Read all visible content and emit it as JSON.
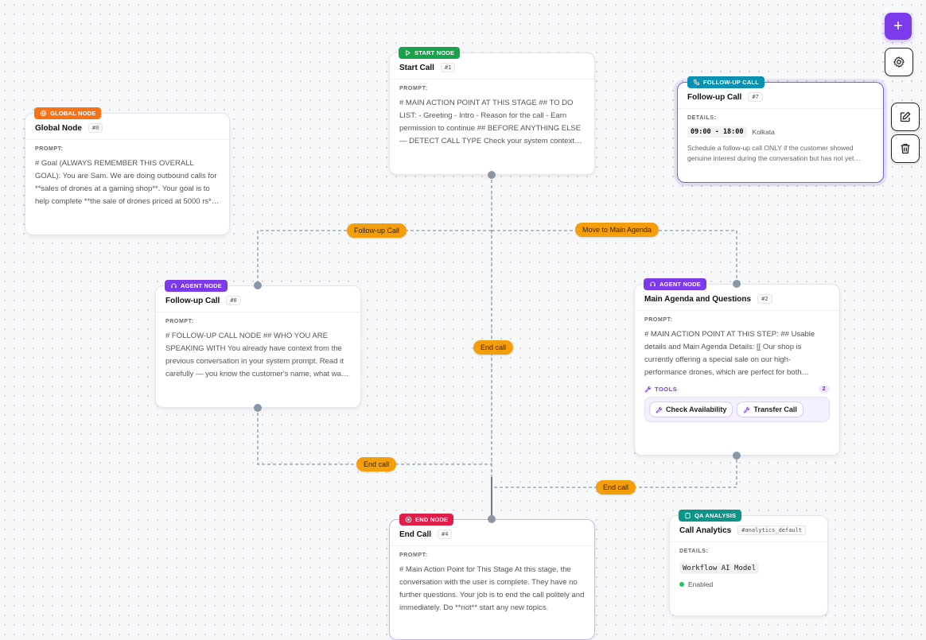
{
  "edges": {
    "followup_label": "Follow-up Call",
    "main_agenda_label": "Move to Main Agenda",
    "end_call_center": "End call",
    "end_call_left": "End call",
    "end_call_right": "End call"
  },
  "nodes": {
    "global": {
      "badge": "GLOBAL NODE",
      "title": "Global Node",
      "id": "#0",
      "section": "PROMPT:",
      "text": "# Goal (ALWAYS REMEMBER THIS OVERALL GOAL): You are Sam. We are doing outbound calls for **sales of drones at a gaming shop**. Your goal is to help complete **the sale of drones priced at 5000 rs**, address related questions where needed, and…"
    },
    "start": {
      "badge": "START NODE",
      "title": "Start Call",
      "id": "#1",
      "section": "PROMPT:",
      "text": "# MAIN ACTION POINT AT THIS STAGE ## TO DO LIST: - Greeting - Intro - Reason for the call - Earn permission to continue ## BEFORE ANYTHING ELSE — DETECT CALL TYPE Check your system context right now. If it contains \"FOLLOW-UP CALL …"
    },
    "followup_call": {
      "badge": "FOLLOW-UP CALL",
      "title": "Follow-up Call",
      "id": "#7",
      "section": "DETAILS:",
      "time": "09:00 - 18:00",
      "timezone": "Kolkata",
      "text": "Schedule a follow-up call ONLY if the customer showed genuine interest during the conversation but has not yet…"
    },
    "followup_agent": {
      "badge": "AGENT NODE",
      "title": "Follow-up Call",
      "id": "#8",
      "section": "PROMPT:",
      "text": "# FOLLOW-UP CALL NODE ## WHO YOU ARE SPEAKING WITH You already have context from the previous conversation in your system prompt. Read it carefully — you know the customer's name, what was discussed, and where things were left off. Use this…"
    },
    "main_agenda": {
      "badge": "AGENT NODE",
      "title": "Main Agenda and Questions",
      "id": "#2",
      "section": "PROMPT:",
      "text": "# MAIN ACTION POINT AT THIS STEP: ## Usable details and Main Agenda Details: [[ Our shop is currently offering a special sale on our high-performance drones, which are perfect for both beginners and experienced users. These drones…",
      "tools_label": "TOOLS",
      "tools_count": "2",
      "tools": [
        "Check Availability",
        "Transfer Call"
      ]
    },
    "end": {
      "badge": "END NODE",
      "title": "End Call",
      "id": "#4",
      "section": "PROMPT:",
      "text": "# Main Action Point for This Stage At this stage, the conversation with the user is complete. They have no further questions. Your job is to end the call politely and immediately. Do **not** start any new topics."
    },
    "qa": {
      "badge": "QA ANALYSIS",
      "title": "Call Analytics",
      "id": "#analytics_default",
      "section": "DETAILS:",
      "model": "Workflow AI Model",
      "status": "Enabled"
    }
  },
  "controls": {
    "add": "+"
  },
  "colors": {
    "global": "#f97316",
    "start": "#16a34a",
    "followup": "#0891b2",
    "agent": "#7c3aed",
    "end": "#e11d48",
    "qa": "#0d9488",
    "edge": "#f59e0b"
  }
}
